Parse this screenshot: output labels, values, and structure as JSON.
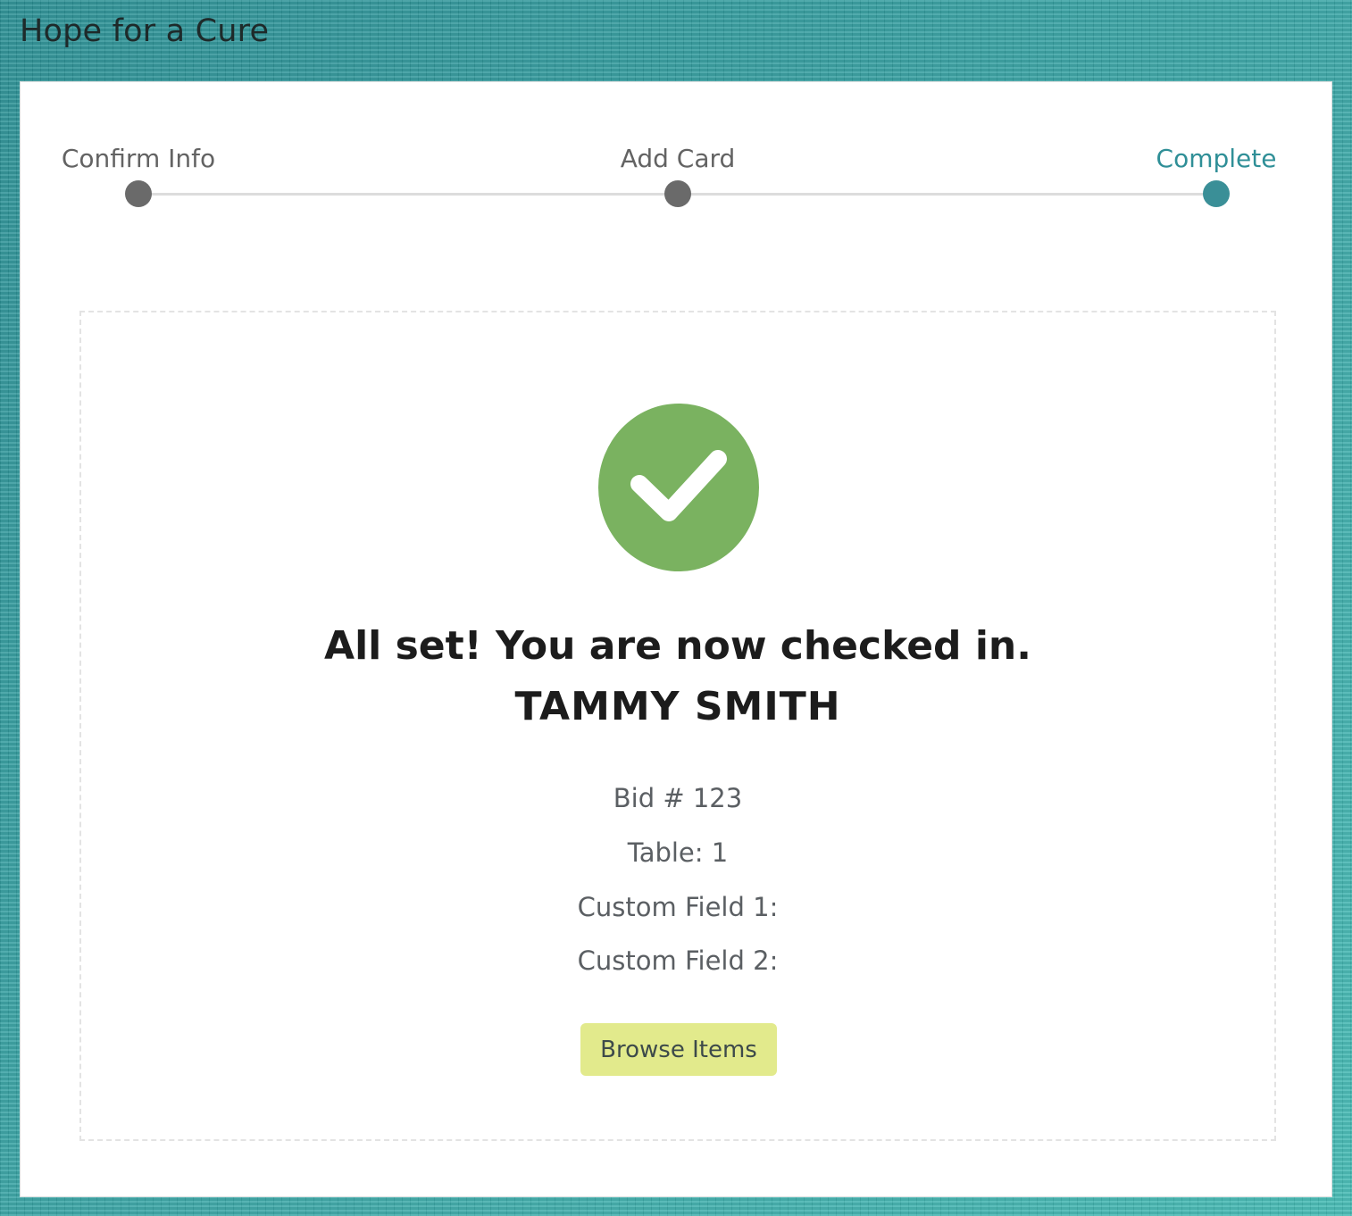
{
  "header": {
    "title": "Hope for a Cure"
  },
  "stepper": {
    "steps": [
      {
        "label": "Confirm Info",
        "state": "done"
      },
      {
        "label": "Add Card",
        "state": "done"
      },
      {
        "label": "Complete",
        "state": "active"
      }
    ]
  },
  "confirmation": {
    "icon": "check-circle-icon",
    "headline": "All set! You are now checked in.",
    "name": "TAMMY SMITH",
    "bid": "Bid # 123",
    "table": "Table: 1",
    "custom_field_1": "Custom Field 1:",
    "custom_field_2": "Custom Field 2:",
    "browse_button_label": "Browse Items"
  },
  "colors": {
    "background": "#2f9a9c",
    "active_step": "#2f8f97",
    "inactive_step": "#6a6a6a",
    "success": "#7ab260",
    "button": "#e2ea8c"
  }
}
